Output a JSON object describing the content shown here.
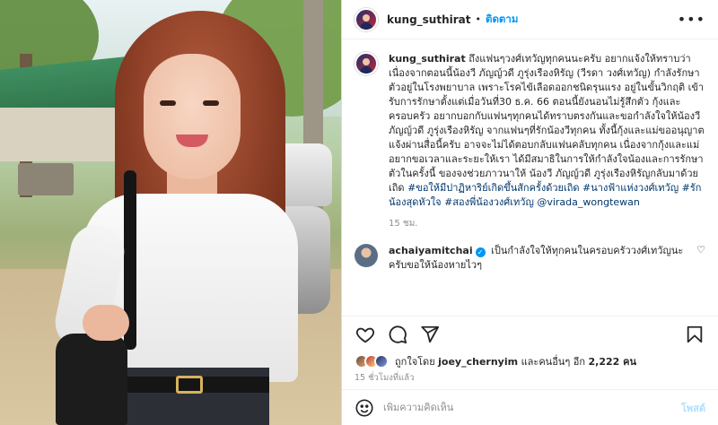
{
  "post": {
    "username": "kung_suthirat",
    "follow_label": "ติดตาม",
    "more_label": "•••",
    "caption": {
      "username": "kung_suthirat",
      "text": "ถึงแฟนๆวงศ์เทวัญทุกคนนะครับ อยากแจ้งให้ทราบว่า เนื่องจากตอนนี้น้องวี ภัญญ์วดี ภูรุ่งเรืองหิรัญ (วีรดา วงศ์เทวัญ) กำลังรักษาตัวอยู่ในโรงพยาบาล เพราะโรคไข้เลือดออกชนิดรุนแรง อยู่ในขั้นวิกฤติ เข้ารับการรักษาตั้งแต่เมื่อวันที่30 ธ.ค. 66 ตอนนี้ยังนอนไม่รู้สึกตัว กุ้งและครอบครัว อยากบอกกับแฟนๆทุกคนได้ทราบตรงกันและขอกำลังใจให้น้องวี ภัญญ์วดี ภูรุ่งเรืองหิรัญ จากแฟนๆที่รักน้องวีทุกคน ทั้งนี้กุ้งและแม่ขออนุญาตแจ้งผ่านสื่อนี้ครับ อาจจะไม่ได้ตอบกลับแฟนคลับทุกคน เนื่องจากกุ้งและแม่อยากขอเวลาและระยะให้เรา ได้มีสมาธิในการให้กำลังใจน้องและการรักษาตัวในครั้งนี้ ของจงช่วยภาวนาให้ น้องวี ภัญญ์วดี ภูรุ่งเรืองหิรัญกลับมาด้วยเถิด",
      "hashtags": "#ขอให้มีปาฏิหาริย์เกิดขึ้นสักครั้งด้วยเถิด #นางฟ้าแห่งวงศ์เทวัญ #รักน้องสุดหัวใจ #สองพี่น้องวงศ์เทวัญ",
      "mention": "@virada_wongtewan",
      "age": "15 ชม."
    },
    "comments": [
      {
        "username": "achaiyamitchai",
        "verified_mark": "✓",
        "text": "เป็นกำลังใจให้ทุกคนในครอบครัววงศ์เทวัญนะครับขอให้น้องหายไวๆ"
      }
    ],
    "likes": {
      "prefix": "ถูกใจโดย",
      "user": "joey_chernyim",
      "middle": "และคนอื่นๆ อีก",
      "count": "2,222 คน"
    },
    "time": "15 ชั่วโมงที่แล้ว",
    "composer": {
      "placeholder": "เพิ่มความคิดเห็น",
      "post_label": "โพสต์"
    },
    "icons": {
      "like": "heart-icon",
      "comment": "comment-icon",
      "share": "send-icon",
      "save": "bookmark-icon",
      "emoji": "emoji-icon"
    },
    "colors": {
      "link": "#0095f6",
      "hashtag": "#00376b",
      "muted": "#8e8e8e",
      "post_disabled": "#b2dffc"
    }
  }
}
